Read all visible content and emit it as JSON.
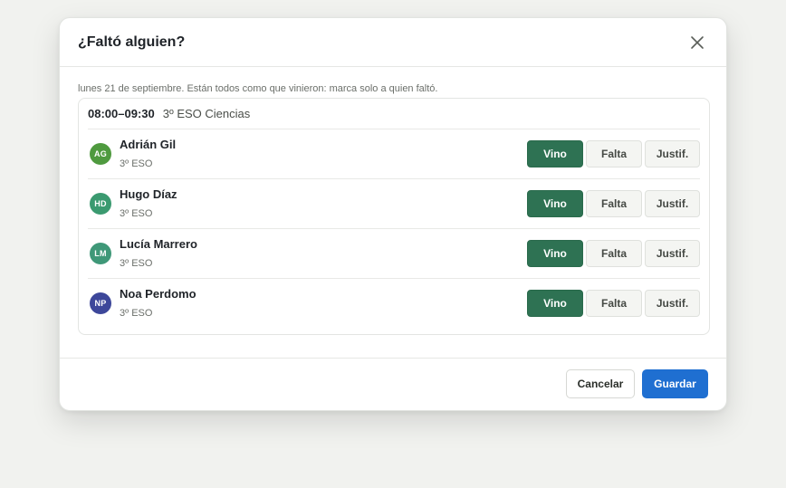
{
  "dialog": {
    "title": "¿Faltó alguien?",
    "close_icon": "close-icon",
    "subtitle": "lunes 21 de septiembre. Están todos como que vinieron: marca solo a quien faltó."
  },
  "slot": {
    "time": "08:00–09:30",
    "group": "3º ESO Ciencias"
  },
  "status_labels": {
    "present": "Vino",
    "absent": "Falta",
    "justified": "Justif."
  },
  "students": [
    {
      "initials": "AG",
      "name": "Adrián Gil",
      "class": "3º ESO",
      "avatar_color": "#4f9a3f",
      "status": "present"
    },
    {
      "initials": "HD",
      "name": "Hugo Díaz",
      "class": "3º ESO",
      "avatar_color": "#3b9a70",
      "status": "present"
    },
    {
      "initials": "LM",
      "name": "Lucía Marrero",
      "class": "3º ESO",
      "avatar_color": "#3f9878",
      "status": "present"
    },
    {
      "initials": "NP",
      "name": "Noa Perdomo",
      "class": "3º ESO",
      "avatar_color": "#3d479a",
      "status": "present"
    }
  ],
  "footer": {
    "cancel_label": "Cancelar",
    "save_label": "Guardar"
  },
  "colors": {
    "accent_green": "#2e7253",
    "primary_blue": "#1f6fd1"
  }
}
